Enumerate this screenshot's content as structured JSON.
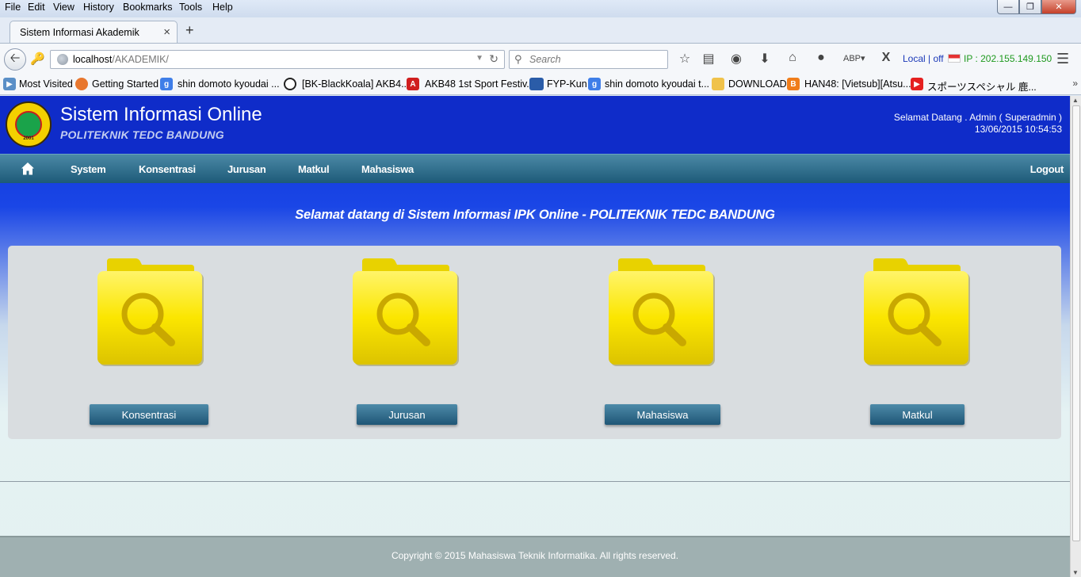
{
  "browser": {
    "menu": [
      "File",
      "Edit",
      "View",
      "History",
      "Bookmarks",
      "Tools",
      "Help"
    ],
    "tab_title": "Sistem Informasi Akademik",
    "url_host": "localhost",
    "url_path": "/AKADEMIK/",
    "search_placeholder": "Search",
    "local_status": "Local | off",
    "ip_status": "IP : 202.155.149.150",
    "bookmarks": [
      "Most Visited",
      "Getting Started",
      "shin domoto kyoudai ...",
      "[BK-BlackKoala] AKB4...",
      "AKB48 1st Sport Festiv...",
      "FYP-Kun",
      "shin domoto kyoudai t...",
      "DOWNLOAD",
      "HAN48: [Vietsub][Atsu...",
      "スポーツスペシャル 鹿..."
    ]
  },
  "site": {
    "title": "Sistem Informasi Online",
    "subtitle": "POLITEKNIK TEDC BANDUNG",
    "welcome_user": "Selamat Datang . Admin ( Superadmin )",
    "datetime": "13/06/2015 10:54:53",
    "nav": [
      "System",
      "Konsentrasi",
      "Jurusan",
      "Matkul",
      "Mahasiswa"
    ],
    "logout": "Logout",
    "welcome_message": "Selamat datang di Sistem Informasi IPK Online - POLITEKNIK TEDC BANDUNG",
    "tiles": [
      "Konsentrasi",
      "Jurusan",
      "Mahasiswa",
      "Matkul"
    ],
    "footer": "Copyright © 2015 Mahasiswa Teknik Informatika. All rights reserved.",
    "logo_text": "2001"
  },
  "colors": {
    "header_blue": "#0f2cc9",
    "nav_teal": "#1d5a78",
    "folder_yellow": "#f5e400",
    "button_teal": "#2a6787"
  }
}
